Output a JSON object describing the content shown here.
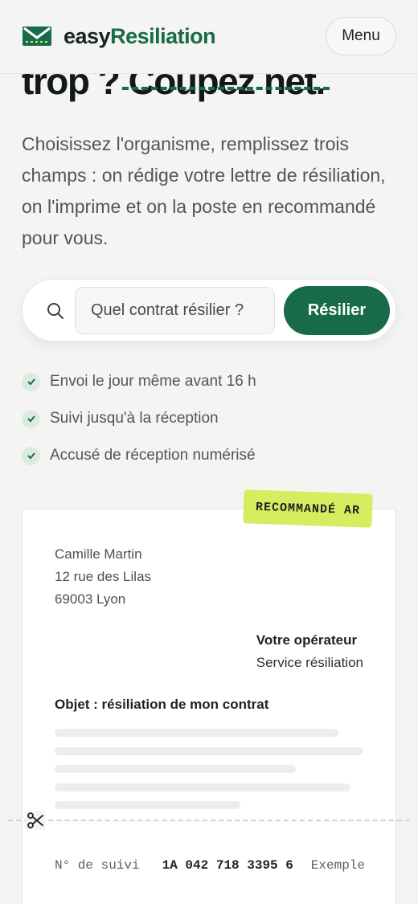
{
  "header": {
    "logo_easy": "easy",
    "logo_brand": "Resiliation",
    "menu_label": "Menu"
  },
  "hero": {
    "title_start": "trop ?",
    "title_struck": "Coupez net.",
    "description": "Choisissez l'organisme, remplissez trois champs : on rédige votre lettre de résiliation, on l'imprime et on la poste en recommandé pour vous."
  },
  "search": {
    "placeholder": "Quel contrat résilier ?",
    "button_label": "Résilier"
  },
  "features": [
    "Envoi le jour même avant 16 h",
    "Suivi jusqu'à la réception",
    "Accusé de réception numérisé"
  ],
  "letter": {
    "stamp": "RECOMMANDÉ AR",
    "sender": {
      "name": "Camille Martin",
      "street": "12 rue des Lilas",
      "city": "69003 Lyon"
    },
    "recipient": {
      "name": "Votre opérateur",
      "dept": "Service résiliation"
    },
    "subject": "Objet : résiliation de mon contrat",
    "tracking": {
      "label": "N° de suivi",
      "number": "1A 042 718 3395 6",
      "note": "Exemple"
    }
  },
  "colors": {
    "brand": "#176b4a",
    "background": "#f4f5f3",
    "stamp": "#d8ec5f",
    "check_bg": "#dcebe2"
  },
  "icons": [
    "envelope-logo-icon",
    "search-icon",
    "check-icon",
    "scissors-icon"
  ]
}
